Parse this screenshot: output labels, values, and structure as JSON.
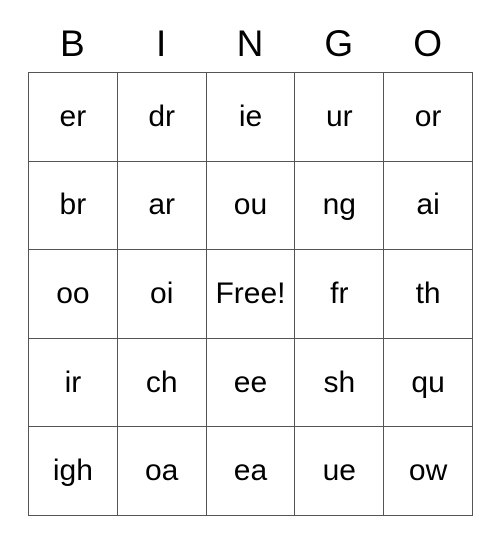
{
  "card": {
    "header_letters": [
      "B",
      "I",
      "N",
      "G",
      "O"
    ],
    "rows": [
      [
        "er",
        "dr",
        "ie",
        "ur",
        "or"
      ],
      [
        "br",
        "ar",
        "ou",
        "ng",
        "ai"
      ],
      [
        "oo",
        "oi",
        "Free!",
        "fr",
        "th"
      ],
      [
        "ir",
        "ch",
        "ee",
        "sh",
        "qu"
      ],
      [
        "igh",
        "oa",
        "ea",
        "ue",
        "ow"
      ]
    ],
    "free_space": {
      "row": 2,
      "column": 2,
      "label": "Free!"
    },
    "colors": {
      "text": "#000000",
      "grid_line": "#555555",
      "background": "#ffffff"
    }
  }
}
